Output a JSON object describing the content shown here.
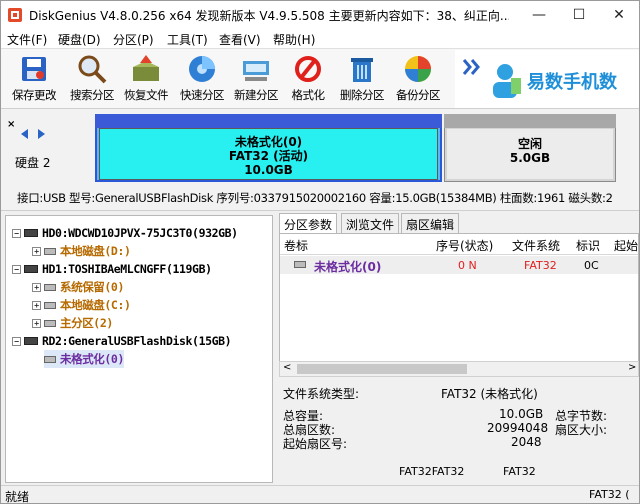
{
  "window": {
    "title": "DiskGenius V4.8.0.256 x64    发现新版本 V4.9.5.508 主要更新内容如下：38、纠正向...",
    "minimize_glyph": "—",
    "maximize_glyph": "☐",
    "close_glyph": "✕"
  },
  "menu": [
    "文件(F)",
    "硬盘(D)",
    "分区(P)",
    "工具(T)",
    "查看(V)",
    "帮助(H)"
  ],
  "toolbar": [
    {
      "label": "保存更改",
      "icon": "save-icon"
    },
    {
      "label": "搜索分区",
      "icon": "search-icon"
    },
    {
      "label": "恢复文件",
      "icon": "recover-box-icon"
    },
    {
      "label": "快速分区",
      "icon": "disk-quick-icon"
    },
    {
      "label": "新建分区",
      "icon": "new-partition-icon"
    },
    {
      "label": "格式化",
      "icon": "format-icon"
    },
    {
      "label": "删除分区",
      "icon": "trash-icon"
    },
    {
      "label": "备份分区",
      "icon": "pie-icon"
    }
  ],
  "banner": {
    "text": "易数手机数"
  },
  "disk": {
    "label": "硬盘 2",
    "used": {
      "line1": "未格式化(0)",
      "line2": "FAT32 (活动)",
      "line3": "10.0GB"
    },
    "free": {
      "line1": "空闲",
      "line2": "5.0GB"
    },
    "info": "接口:USB  型号:GeneralUSBFlashDisk  序列号:0337915020002160  容量:15.0GB(15384MB)  柱面数:1961  磁头数:2"
  },
  "tree": [
    {
      "text": "HD0:WDCWD10JPVX-75JC3T0(932GB)",
      "level": 0,
      "kind": "disk",
      "color": "dark"
    },
    {
      "text": "本地磁盘(D:)",
      "level": 1,
      "kind": "part",
      "color": "orange"
    },
    {
      "text": "HD1:TOSHIBAeMLCNGFF(119GB)",
      "level": 0,
      "kind": "disk",
      "color": "dark"
    },
    {
      "text": "系统保留(0)",
      "level": 1,
      "kind": "part",
      "color": "orange"
    },
    {
      "text": "本地磁盘(C:)",
      "level": 1,
      "kind": "part",
      "color": "orange"
    },
    {
      "text": "主分区(2)",
      "level": 1,
      "kind": "part",
      "color": "orange"
    },
    {
      "text": "RD2:GeneralUSBFlashDisk(15GB)",
      "level": 0,
      "kind": "disk",
      "color": "dark"
    },
    {
      "text": "未格式化(0)",
      "level": 1,
      "kind": "part",
      "color": "purple"
    }
  ],
  "tabs": [
    "分区参数",
    "浏览文件",
    "扇区编辑"
  ],
  "table": {
    "headers": [
      "卷标",
      "序号(状态)",
      "文件系统",
      "标识",
      "起始"
    ],
    "row": {
      "name": "未格式化(0)",
      "index": "0 N",
      "fs": "FAT32",
      "id": "0C"
    }
  },
  "details": {
    "fs_type_label": "文件系统类型:",
    "fs_type_value": "FAT32 (未格式化)",
    "total_label": "总容量:",
    "total_value": "10.0GB",
    "sectors_label": "总扇区数:",
    "sectors_value": "20994048",
    "start_label": "起始扇区号:",
    "start_value": "2048",
    "total_bytes_label": "总字节数:",
    "sector_size_label": "扇区大小:",
    "bottom_a": "FAT32FAT32",
    "bottom_b": "FAT32"
  },
  "status": {
    "left": "就绪",
    "right": "FAT32 ("
  }
}
